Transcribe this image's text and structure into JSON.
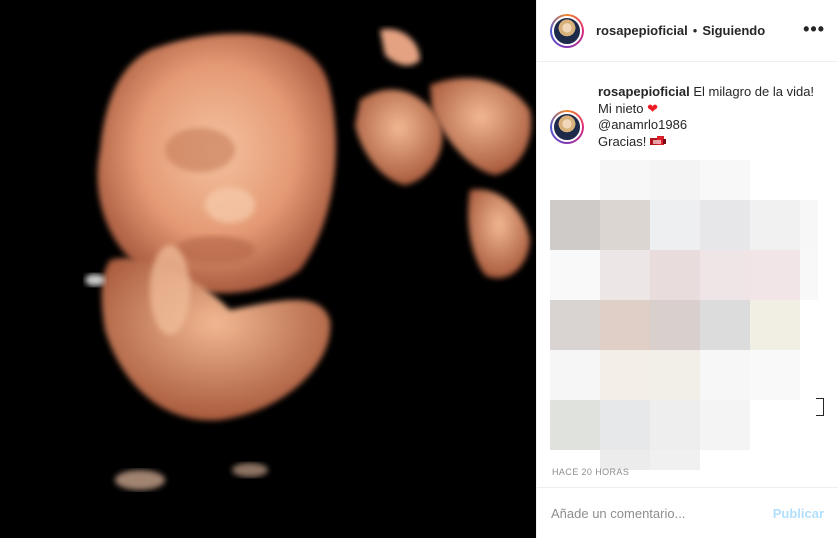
{
  "post": {
    "image_description": "3D ultrasound of a baby",
    "colors": {
      "skin": "#e8a17c",
      "background": "#000000"
    }
  },
  "header": {
    "username": "rosapepioficial",
    "separator": "•",
    "follow_status": "Siguiendo",
    "more_icon": "more-horizontal-icon",
    "more_glyph": "•••"
  },
  "caption": {
    "username": "rosapepioficial",
    "line1": "El milagro de la vida!",
    "line2": "Mi nieto",
    "heart": "❤",
    "mention": "@anamrlo1986",
    "line4": "Gracias!"
  },
  "timestamp": "HACE 20 HORAS",
  "comment": {
    "placeholder": "Añade un comentario...",
    "post_label": "Publicar"
  }
}
